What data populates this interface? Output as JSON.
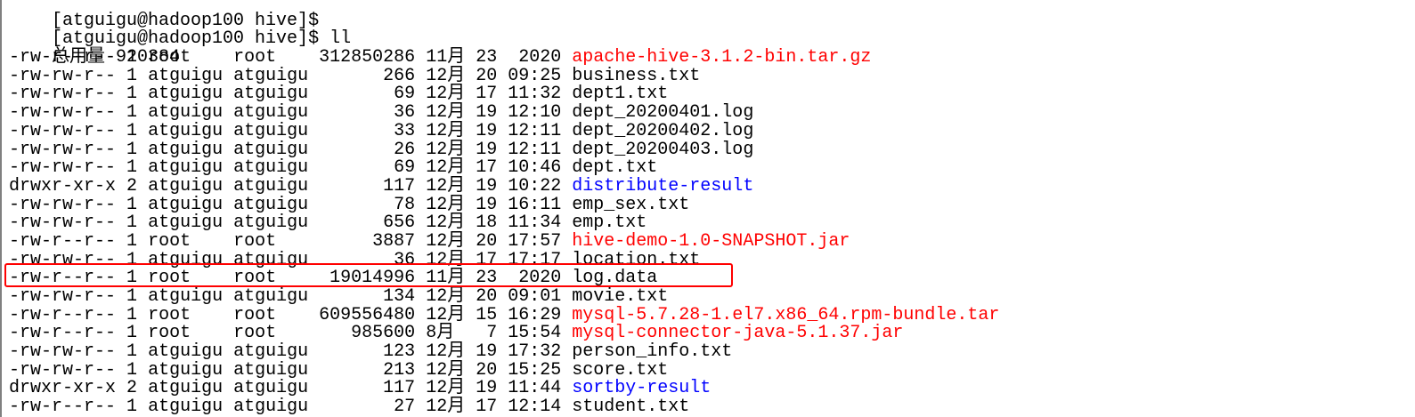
{
  "terminal": {
    "prompt_top": "[atguigu@hadoop100 hive]$",
    "prompt_cmd": "[atguigu@hadoop100 hive]$ ll",
    "total": "总用量 920384",
    "rows": [
      {
        "perm": "-rw-r--r--",
        "links": "1",
        "owner": "root   ",
        "group": "root   ",
        "size": "312850286",
        "month": "11月",
        "day": "23",
        "time": " 2020",
        "name": "apache-hive-3.1.2-bin.tar.gz",
        "color": "red"
      },
      {
        "perm": "-rw-rw-r--",
        "links": "1",
        "owner": "atguigu",
        "group": "atguigu",
        "size": "      266",
        "month": "12月",
        "day": "20",
        "time": "09:25",
        "name": "business.txt",
        "color": "plain"
      },
      {
        "perm": "-rw-rw-r--",
        "links": "1",
        "owner": "atguigu",
        "group": "atguigu",
        "size": "       69",
        "month": "12月",
        "day": "17",
        "time": "11:32",
        "name": "dept1.txt",
        "color": "plain"
      },
      {
        "perm": "-rw-rw-r--",
        "links": "1",
        "owner": "atguigu",
        "group": "atguigu",
        "size": "       36",
        "month": "12月",
        "day": "19",
        "time": "12:10",
        "name": "dept_20200401.log",
        "color": "plain"
      },
      {
        "perm": "-rw-rw-r--",
        "links": "1",
        "owner": "atguigu",
        "group": "atguigu",
        "size": "       33",
        "month": "12月",
        "day": "19",
        "time": "12:11",
        "name": "dept_20200402.log",
        "color": "plain"
      },
      {
        "perm": "-rw-rw-r--",
        "links": "1",
        "owner": "atguigu",
        "group": "atguigu",
        "size": "       26",
        "month": "12月",
        "day": "19",
        "time": "12:11",
        "name": "dept_20200403.log",
        "color": "plain"
      },
      {
        "perm": "-rw-rw-r--",
        "links": "1",
        "owner": "atguigu",
        "group": "atguigu",
        "size": "       69",
        "month": "12月",
        "day": "17",
        "time": "10:46",
        "name": "dept.txt",
        "color": "plain"
      },
      {
        "perm": "drwxr-xr-x",
        "links": "2",
        "owner": "atguigu",
        "group": "atguigu",
        "size": "      117",
        "month": "12月",
        "day": "19",
        "time": "10:22",
        "name": "distribute-result",
        "color": "blue"
      },
      {
        "perm": "-rw-rw-r--",
        "links": "1",
        "owner": "atguigu",
        "group": "atguigu",
        "size": "       78",
        "month": "12月",
        "day": "19",
        "time": "16:11",
        "name": "emp_sex.txt",
        "color": "plain"
      },
      {
        "perm": "-rw-rw-r--",
        "links": "1",
        "owner": "atguigu",
        "group": "atguigu",
        "size": "      656",
        "month": "12月",
        "day": "18",
        "time": "11:34",
        "name": "emp.txt",
        "color": "plain"
      },
      {
        "perm": "-rw-r--r--",
        "links": "1",
        "owner": "root   ",
        "group": "root   ",
        "size": "     3887",
        "month": "12月",
        "day": "20",
        "time": "17:57",
        "name": "hive-demo-1.0-SNAPSHOT.jar",
        "color": "red"
      },
      {
        "perm": "-rw-rw-r--",
        "links": "1",
        "owner": "atguigu",
        "group": "atguigu",
        "size": "       36",
        "month": "12月",
        "day": "17",
        "time": "17:17",
        "name": "location.txt",
        "color": "plain"
      },
      {
        "perm": "-rw-r--r--",
        "links": "1",
        "owner": "root   ",
        "group": "root   ",
        "size": " 19014996",
        "month": "11月",
        "day": "23",
        "time": " 2020",
        "name": "log.data",
        "color": "plain"
      },
      {
        "perm": "-rw-rw-r--",
        "links": "1",
        "owner": "atguigu",
        "group": "atguigu",
        "size": "      134",
        "month": "12月",
        "day": "20",
        "time": "09:01",
        "name": "movie.txt",
        "color": "plain"
      },
      {
        "perm": "-rw-r--r--",
        "links": "1",
        "owner": "root   ",
        "group": "root   ",
        "size": "609556480",
        "month": "12月",
        "day": "15",
        "time": "16:29",
        "name": "mysql-5.7.28-1.el7.x86_64.rpm-bundle.tar",
        "color": "red"
      },
      {
        "perm": "-rw-r--r--",
        "links": "1",
        "owner": "root   ",
        "group": "root   ",
        "size": "   985600",
        "month": "8月 ",
        "day": " 7",
        "time": "15:54",
        "name": "mysql-connector-java-5.1.37.jar",
        "color": "red"
      },
      {
        "perm": "-rw-rw-r--",
        "links": "1",
        "owner": "atguigu",
        "group": "atguigu",
        "size": "      123",
        "month": "12月",
        "day": "19",
        "time": "17:32",
        "name": "person_info.txt",
        "color": "plain"
      },
      {
        "perm": "-rw-rw-r--",
        "links": "1",
        "owner": "atguigu",
        "group": "atguigu",
        "size": "      213",
        "month": "12月",
        "day": "20",
        "time": "15:25",
        "name": "score.txt",
        "color": "plain"
      },
      {
        "perm": "drwxr-xr-x",
        "links": "2",
        "owner": "atguigu",
        "group": "atguigu",
        "size": "      117",
        "month": "12月",
        "day": "19",
        "time": "11:44",
        "name": "sortby-result",
        "color": "blue"
      },
      {
        "perm": "-rw-r--r--",
        "links": "1",
        "owner": "atguigu",
        "group": "atguigu",
        "size": "       27",
        "month": "12月",
        "day": "17",
        "time": "12:14",
        "name": "student.txt",
        "color": "plain"
      }
    ]
  },
  "colors": {
    "executable_red": "#ff0000",
    "directory_blue": "#0000ff",
    "highlight_border": "#ff0000",
    "background": "#ffffff"
  }
}
